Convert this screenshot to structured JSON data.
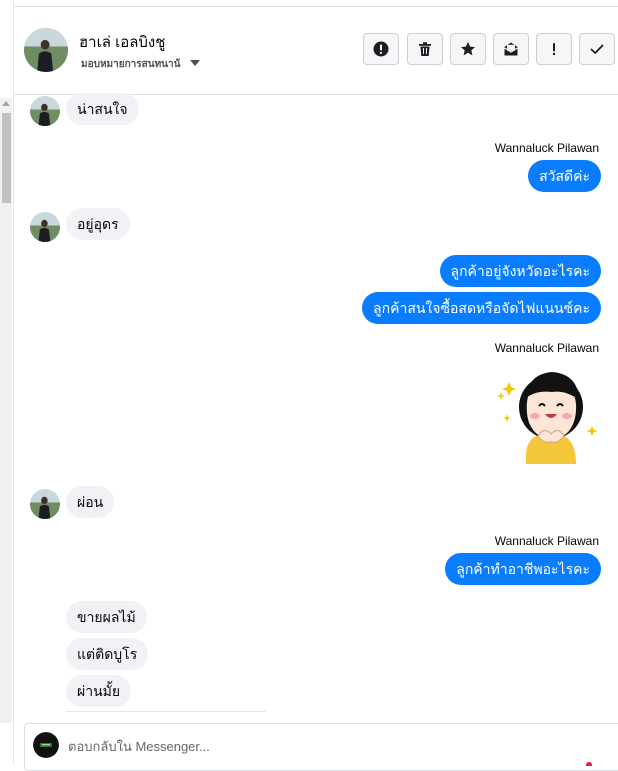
{
  "header": {
    "contact_name": "ฮาเล่ เอลบิงชู",
    "contact_status": "มอบหมายการสนทนาน้",
    "toolbar": [
      {
        "name": "spam-button",
        "icon": "exclamation-circle-icon"
      },
      {
        "name": "delete-button",
        "icon": "trash-icon"
      },
      {
        "name": "star-button",
        "icon": "star-icon"
      },
      {
        "name": "mark-unread-button",
        "icon": "envelope-open-icon"
      },
      {
        "name": "priority-button",
        "icon": "exclamation-icon"
      },
      {
        "name": "done-button",
        "icon": "check-icon"
      }
    ]
  },
  "messages": {
    "m1": "น่าสนใจ",
    "sender1": "Wannaluck Pilawan",
    "m2": "สวัสดีค่ะ",
    "m3": "อยู่อุดร",
    "m4": "ลูกค้าอยู่จังหวัดอะไรคะ",
    "m5": "ลูกค้าสนใจซื้อสดหรือจัดไฟแนนซ์คะ",
    "sender2": "Wannaluck Pilawan",
    "m6": "ผ่อน",
    "sender3": "Wannaluck Pilawan",
    "m7": "ลูกค้าทำอาชีพอะไรคะ",
    "m8": "ขายผลไม้",
    "m9": "แต่ติดบูโร",
    "m10": "ผ่านมั้ย"
  },
  "composer": {
    "placeholder": "ตอบกลับใน Messenger..."
  },
  "colors": {
    "outgoing_bubble": "#0a7cff",
    "incoming_bubble": "#f0f2f5",
    "toolbar_bg": "#f5f6f7",
    "divider": "#dadde1"
  }
}
